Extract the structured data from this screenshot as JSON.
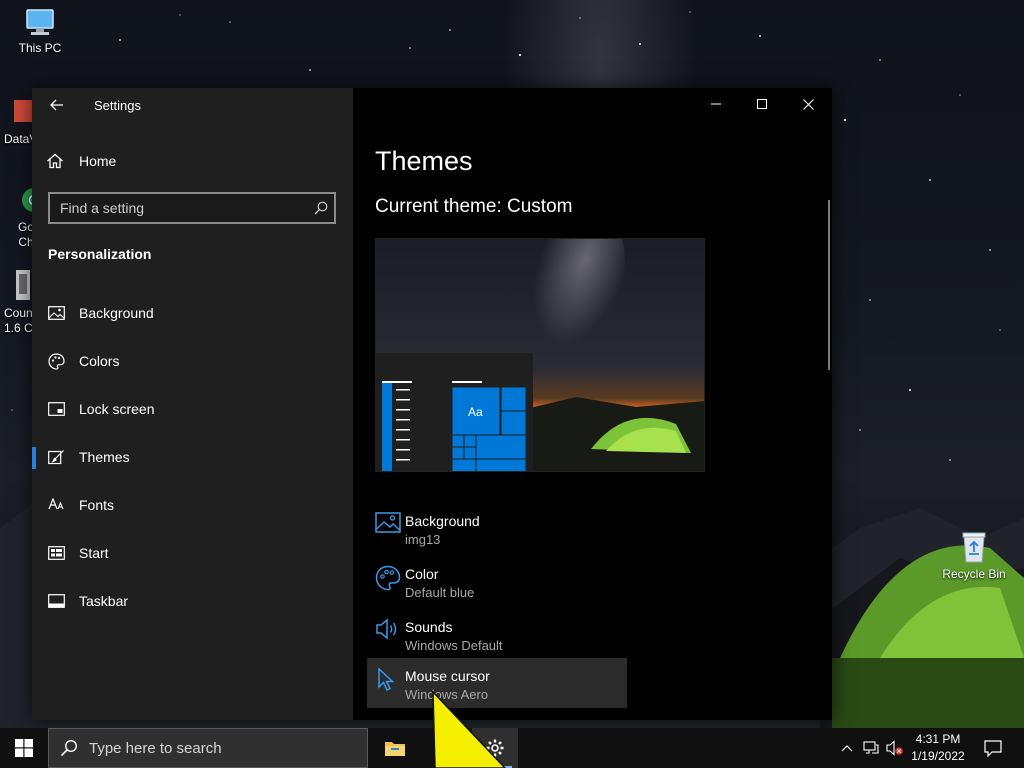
{
  "desktop": {
    "icons": [
      {
        "label": "This PC",
        "icon": "computer-icon"
      },
      {
        "label": "DataV",
        "icon": "datav-app-icon"
      },
      {
        "label": "Go\nCh",
        "icon": "chrome-icon"
      },
      {
        "label": "Coun\n1.6 C",
        "icon": "counter-strike-icon"
      },
      {
        "label": "Recycle Bin",
        "icon": "recycle-bin-icon"
      }
    ]
  },
  "settings": {
    "app_title": "Settings",
    "home_label": "Home",
    "search_placeholder": "Find a setting",
    "section_title": "Personalization",
    "nav_items": [
      {
        "label": "Background",
        "icon": "picture-icon",
        "selected": false
      },
      {
        "label": "Colors",
        "icon": "palette-icon",
        "selected": false
      },
      {
        "label": "Lock screen",
        "icon": "lock-screen-icon",
        "selected": false
      },
      {
        "label": "Themes",
        "icon": "brush-icon",
        "selected": true
      },
      {
        "label": "Fonts",
        "icon": "fonts-icon",
        "selected": false
      },
      {
        "label": "Start",
        "icon": "start-icon",
        "selected": false
      },
      {
        "label": "Taskbar",
        "icon": "taskbar-icon",
        "selected": false
      }
    ],
    "page_title": "Themes",
    "current_theme": "Current theme: Custom",
    "preview_sample_text": "Aa",
    "properties": [
      {
        "name": "Background",
        "value": "img13",
        "icon": "picture-icon"
      },
      {
        "name": "Color",
        "value": "Default blue",
        "icon": "palette-icon"
      },
      {
        "name": "Sounds",
        "value": "Windows Default",
        "icon": "speaker-icon"
      },
      {
        "name": "Mouse cursor",
        "value": "Windows Aero",
        "icon": "mouse-pointer-icon"
      }
    ],
    "accent_color": "#0078d7"
  },
  "taskbar": {
    "search_placeholder": "Type here to search",
    "time": "4:31 PM",
    "date": "1/19/2022"
  }
}
